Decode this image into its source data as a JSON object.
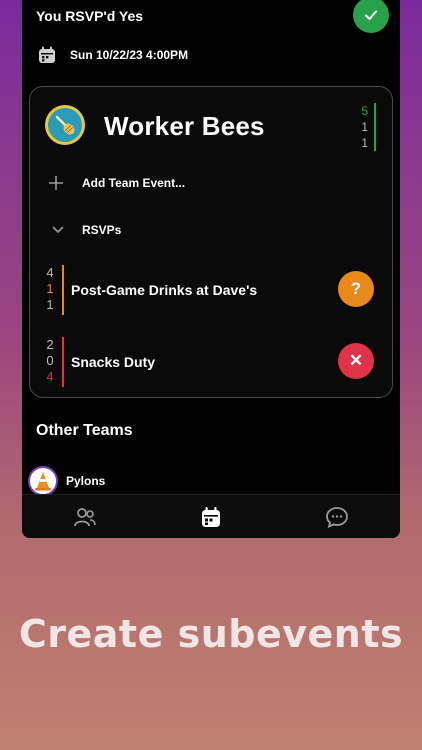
{
  "rsvp_status": "You RSVP'd Yes",
  "event_date": "Sun 10/22/23 4:00PM",
  "team": {
    "name": "Worker Bees",
    "counts": [
      "5",
      "1",
      "1"
    ],
    "count_colors": [
      "#27a24a",
      "#bbbbbb",
      "#bbbbbb"
    ]
  },
  "add_team_event_label": "Add Team Event...",
  "rsvps_label": "RSVPs",
  "subevents": [
    {
      "counts": [
        "4",
        "1",
        "1"
      ],
      "count_colors": [
        "#bbbbbb",
        "#e8891a",
        "#bbbbbb"
      ],
      "bar_color": "#e8891a",
      "title": "Post-Game Drinks at Dave's",
      "action_symbol": "?",
      "action_color": "#e8891a"
    },
    {
      "counts": [
        "2",
        "0",
        "4"
      ],
      "count_colors": [
        "#bbbbbb",
        "#bbbbbb",
        "#e0334a"
      ],
      "bar_color": "#e0334a",
      "title": "Snacks Duty",
      "action_symbol": "✕",
      "action_color": "#e0334a"
    }
  ],
  "other_teams_title": "Other Teams",
  "other_teams": [
    {
      "name": "Pylons"
    }
  ],
  "tabs": [
    {
      "icon": "people-icon"
    },
    {
      "icon": "calendar-icon"
    },
    {
      "icon": "chat-icon"
    }
  ],
  "caption": "Create subevents"
}
